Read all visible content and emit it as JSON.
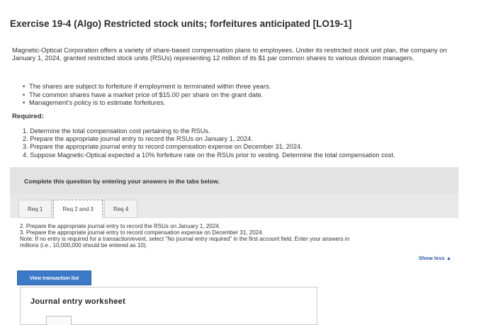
{
  "title": "Exercise 19-4 (Algo) Restricted stock units; forfeitures anticipated [LO19-1]",
  "intro": "Magnetic-Optical Corporation offers a variety of share-based compensation plans to employees. Under its restricted stock unit plan, the company on January 1, 2024, granted restricted stock units (RSUs) representing 12 million of its $1 par common shares to various division managers.",
  "bullets": [
    "The shares are subject to forfeiture if employment is terminated within three years.",
    "The common shares have a market price of $15.00 per share on the grant date.",
    "Management's policy is to estimate forfeitures."
  ],
  "required_label": "Required:",
  "requirements": [
    "1. Determine the total compensation cost pertaining to the RSUs.",
    "2. Prepare the appropriate journal entry to record the RSUs on January 1, 2024.",
    "3. Prepare the appropriate journal entry to record compensation expense on December 31, 2024.",
    "4. Suppose Magnetic-Optical expected a 10% forfeiture rate on the RSUs prior to vesting. Determine the total compensation cost."
  ],
  "instruction": "Complete this question by entering your answers in the tabs below.",
  "tabs": [
    "Req 1",
    "Req 2 and 3",
    "Req 4"
  ],
  "active_tab": "Req 2 and 3",
  "tab_content": {
    "line1": "2. Prepare the appropriate journal entry to record the RSUs on January 1, 2024.",
    "line2": "3. Prepare the appropriate journal entry to record compensation expense on December 31, 2024.",
    "note1": "Note: If no entry is required for a transaction/event, select \"No journal entry required\" in the first account field. Enter your answers in",
    "note2": "millions (i.e., 10,000,000 should be entered as 10).",
    "show_less": "Show less ▲"
  },
  "view_button": "View transaction list",
  "worksheet_title": "Journal entry worksheet"
}
